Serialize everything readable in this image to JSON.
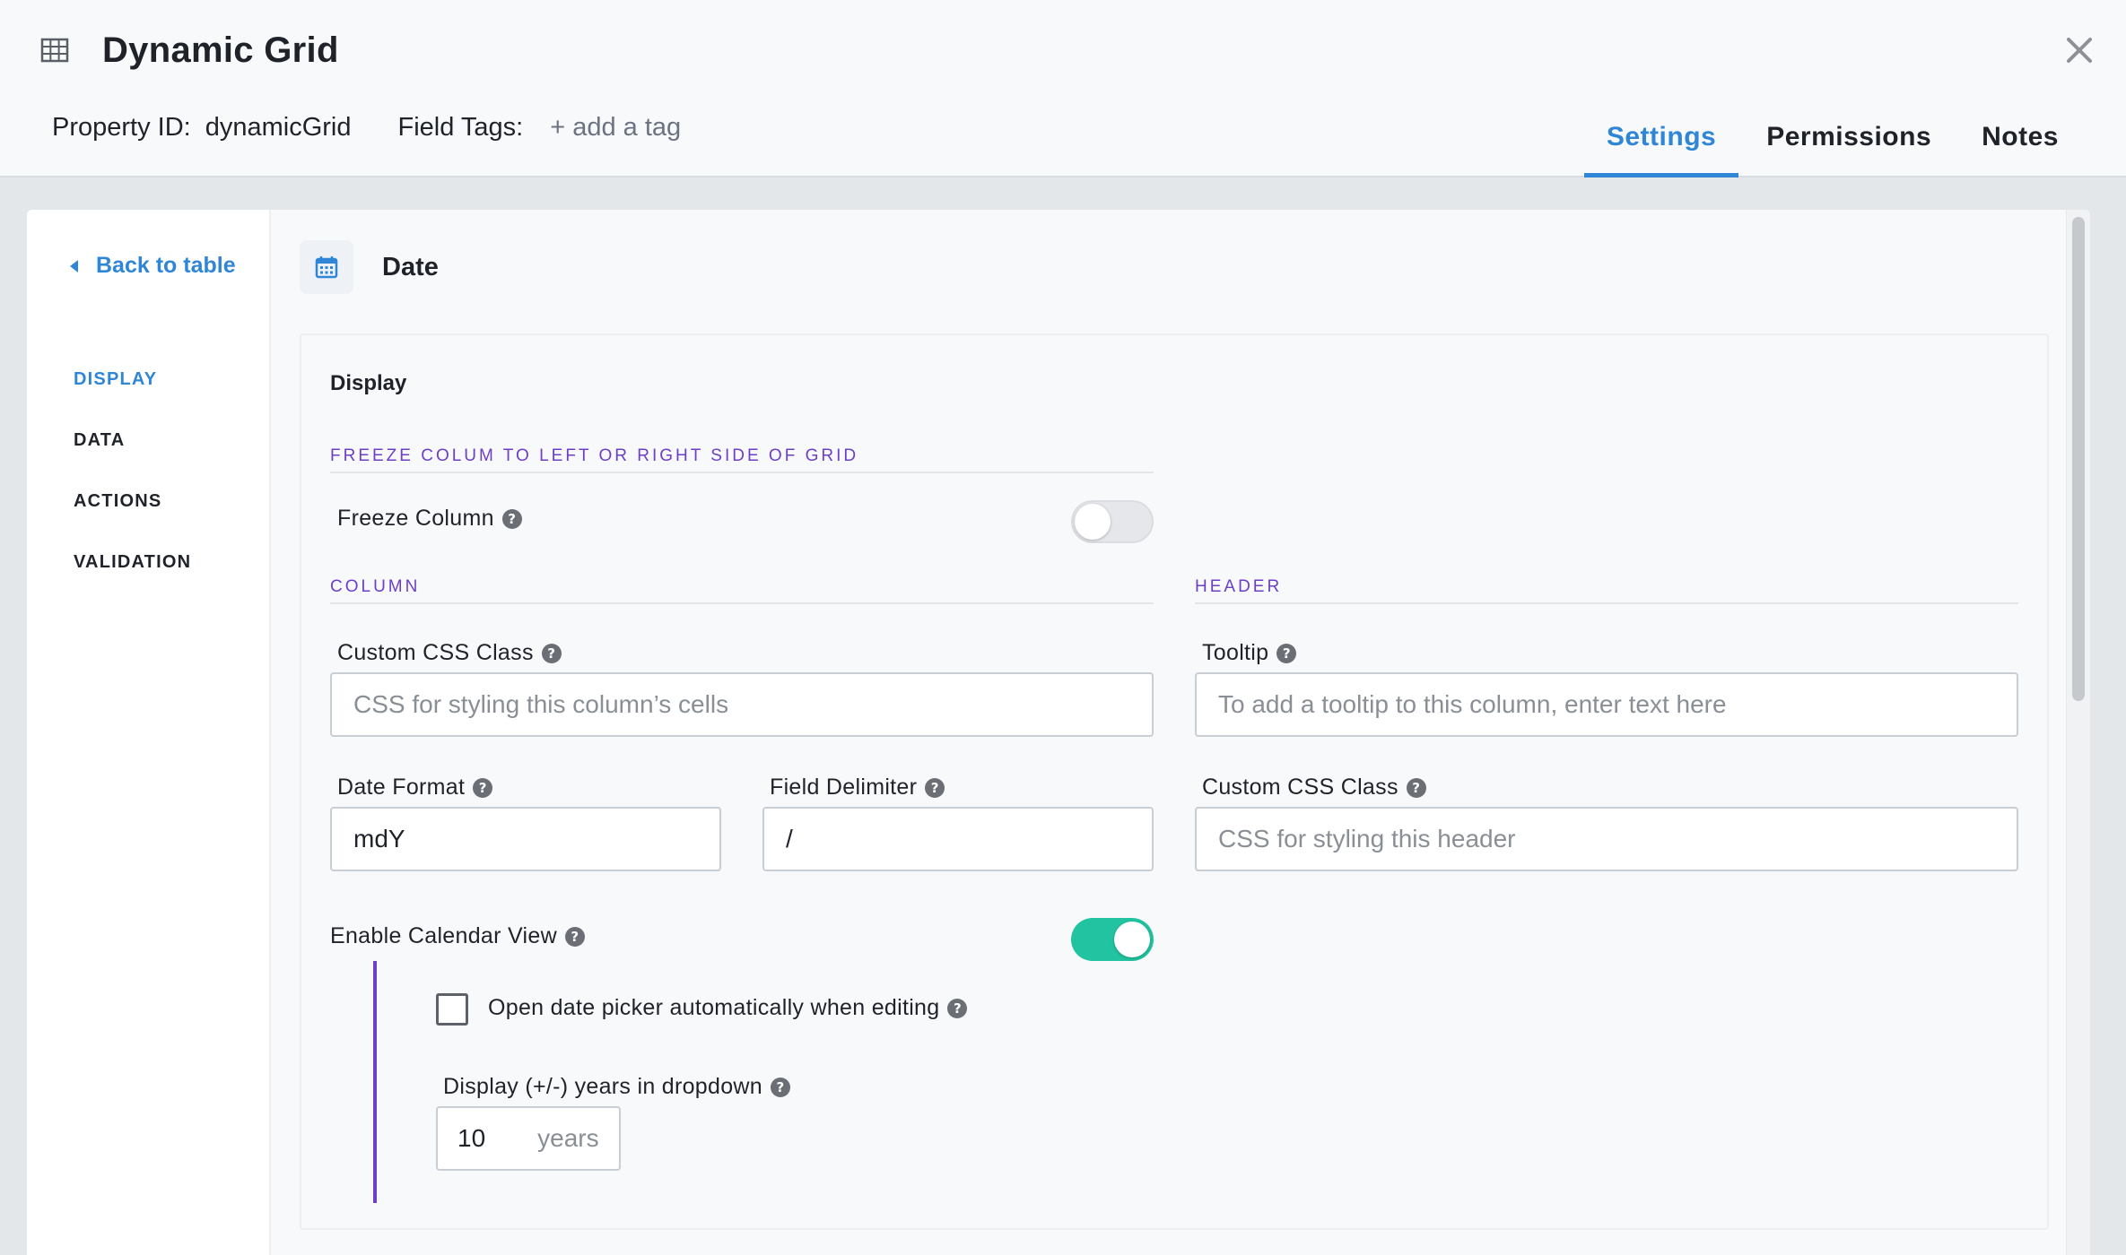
{
  "header": {
    "title": "Dynamic Grid",
    "property_id_label": "Property ID:",
    "property_id_value": "dynamicGrid",
    "field_tags_label": "Field Tags:",
    "add_tag": "+ add a tag",
    "tabs": [
      {
        "label": "Settings",
        "active": true
      },
      {
        "label": "Permissions",
        "active": false
      },
      {
        "label": "Notes",
        "active": false
      }
    ]
  },
  "sidebar": {
    "back_label": "Back to table",
    "items": [
      {
        "label": "DISPLAY",
        "active": true
      },
      {
        "label": "DATA",
        "active": false
      },
      {
        "label": "ACTIONS",
        "active": false
      },
      {
        "label": "VALIDATION",
        "active": false
      }
    ]
  },
  "content": {
    "column_title": "Date",
    "card_title": "Display",
    "freeze_section": "FREEZE COLUM TO LEFT OR RIGHT SIDE OF GRID",
    "freeze_label": "Freeze Column",
    "freeze_on": false,
    "column_section": "COLUMN",
    "header_section": "HEADER",
    "column_css_label": "Custom CSS Class",
    "column_css_placeholder": "CSS for styling this column’s cells",
    "tooltip_label": "Tooltip",
    "tooltip_placeholder": "To add a tooltip to this column, enter text here",
    "date_format_label": "Date Format",
    "date_format_value": "mdY",
    "delimiter_label": "Field Delimiter",
    "delimiter_value": "/",
    "header_css_label": "Custom CSS Class",
    "header_css_placeholder": "CSS for styling this header",
    "calendar_label": "Enable Calendar View",
    "calendar_on": true,
    "open_picker_label": "Open date picker automatically when editing",
    "open_picker_checked": false,
    "years_label": "Display (+/-) years in dropdown",
    "years_value": "10",
    "years_unit": "years"
  },
  "colors": {
    "accent_blue": "#2f86d6",
    "section_purple": "#6c3fc5",
    "toggle_on": "#22c3a0"
  },
  "icons": [
    "grid-icon",
    "close-icon",
    "caret-left-icon",
    "calendar-icon",
    "help-icon"
  ]
}
